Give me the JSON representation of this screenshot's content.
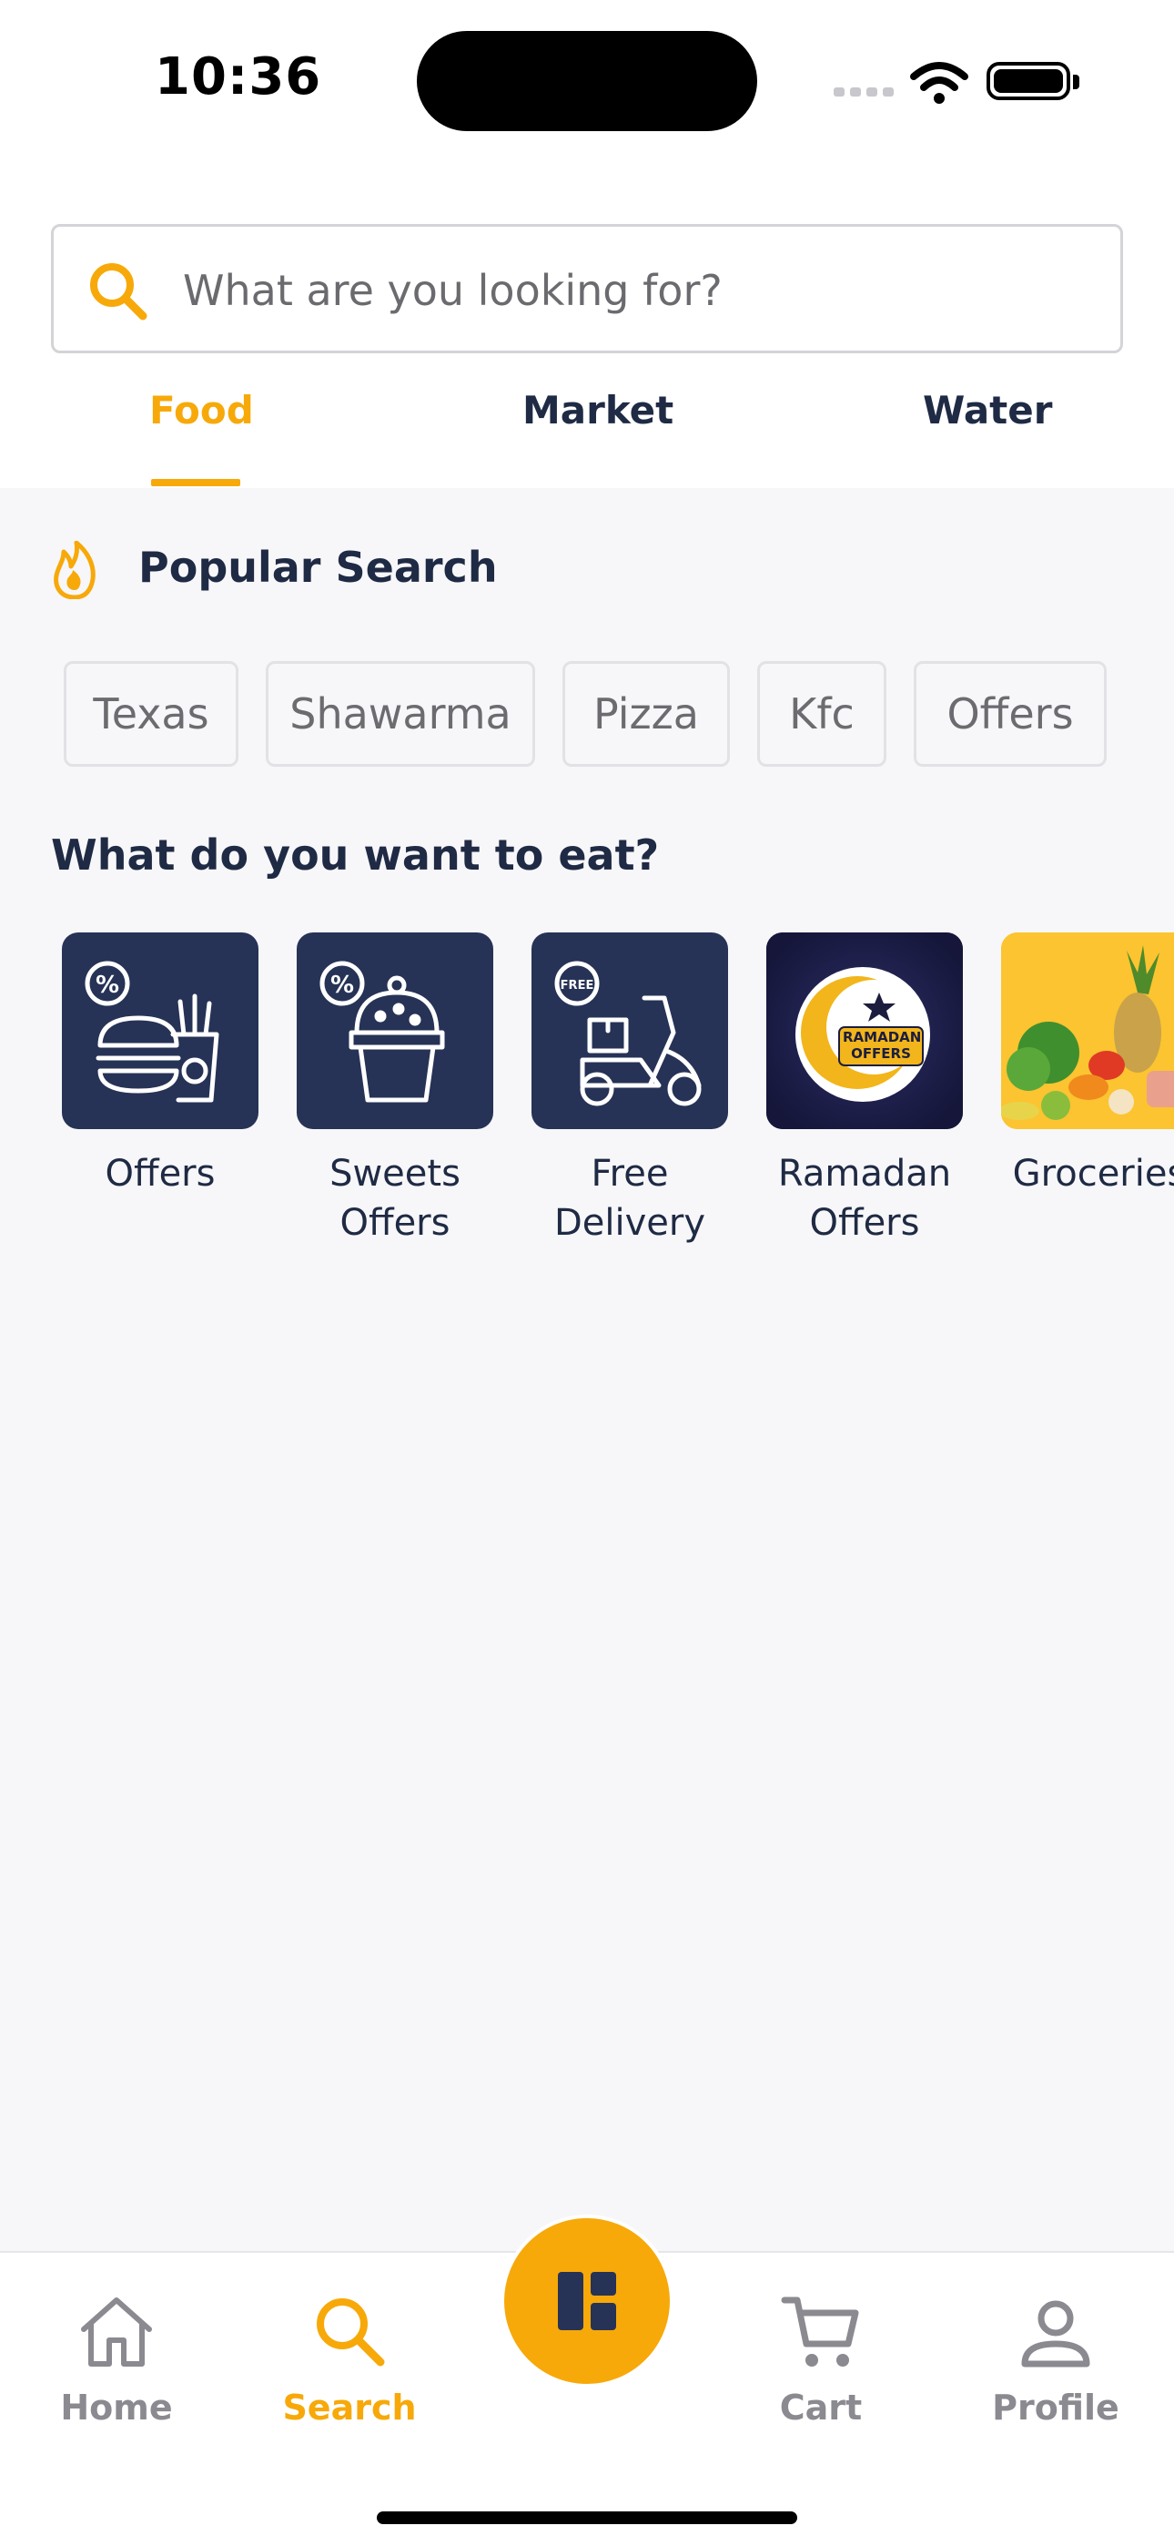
{
  "status_bar": {
    "time": "10:36"
  },
  "search": {
    "placeholder": "What are you looking for?"
  },
  "tabs": [
    {
      "label": "Food",
      "active": true
    },
    {
      "label": "Market",
      "active": false
    },
    {
      "label": "Water",
      "active": false
    }
  ],
  "popular": {
    "title": "Popular Search",
    "chips": [
      "Texas",
      "Shawarma",
      "Pizza",
      "Kfc",
      "Offers"
    ]
  },
  "categories": {
    "title": "What do you want to eat?",
    "items": [
      {
        "label": "Offers",
        "icon": "burger-fries-icon"
      },
      {
        "label": "Sweets Offers",
        "icon": "cupcake-icon"
      },
      {
        "label": "Free Delivery",
        "icon": "scooter-icon"
      },
      {
        "label": "Ramadan Offers",
        "icon": "ramadan-crescent-icon",
        "badge_text": "RAMADAN OFFERS"
      },
      {
        "label": "Groceries",
        "icon": "groceries-image"
      }
    ]
  },
  "bottom_nav": {
    "items": [
      {
        "label": "Home",
        "icon": "home-icon",
        "active": false
      },
      {
        "label": "Search",
        "icon": "search-icon",
        "active": true
      },
      {
        "label": "Cart",
        "icon": "cart-icon",
        "active": false
      },
      {
        "label": "Profile",
        "icon": "profile-icon",
        "active": false
      }
    ],
    "center_icon": "dashboard-icon"
  },
  "colors": {
    "accent": "#f7a90a",
    "navy": "#263356",
    "text": "#1f2a44"
  }
}
